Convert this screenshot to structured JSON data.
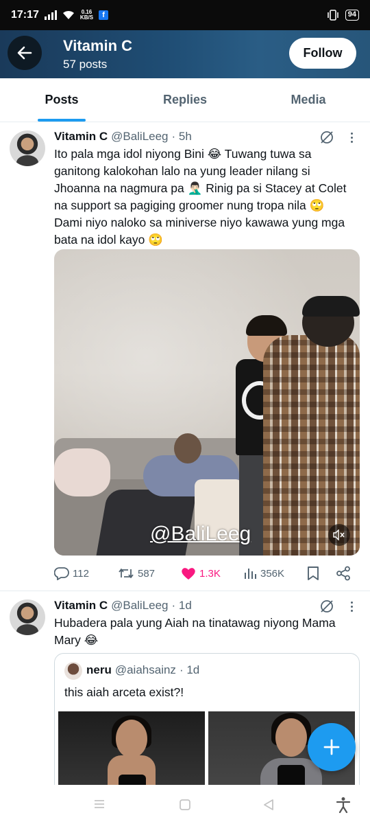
{
  "status_bar": {
    "time": "17:17",
    "speed_value": "0.16",
    "speed_unit": "KB/S",
    "app_badge": "f",
    "battery": "94"
  },
  "header": {
    "name": "Vitamin C",
    "posts_count": "57 posts",
    "follow_label": "Follow",
    "banner_color": "#1f4d74"
  },
  "tabs": [
    {
      "label": "Posts",
      "active": true
    },
    {
      "label": "Replies",
      "active": false
    },
    {
      "label": "Media",
      "active": false
    }
  ],
  "posts": [
    {
      "name": "Vitamin C",
      "handle": "@BaliLeeg",
      "time": "· 5h",
      "text": "Ito pala mga idol niyong Bini 😂 Tuwang tuwa sa ganitong kalokohan lalo na yung leader nilang si Jhoanna na nagmura pa 🤦🏻‍♂️ Rinig pa si Stacey at Colet na support sa pagiging groomer nung tropa nila 🙄 Dami niyo naloko sa miniverse niyo kawawa yung mga bata na idol kayo 🙄",
      "video_watermark": "@BaliLeeg",
      "replies": "112",
      "reposts": "587",
      "likes": "1.3K",
      "views": "356K",
      "like_color": "#f91880"
    },
    {
      "name": "Vitamin C",
      "handle": "@BaliLeeg",
      "time": "· 1d",
      "text": "Hubadera pala yung Aiah na tinatawag niyong Mama Mary 😂",
      "quote": {
        "name": "neru",
        "handle": "@aiahsainz",
        "time": "· 1d",
        "text": "this aiah arceta exist?!"
      }
    }
  ],
  "accent_color": "#1d9bf0"
}
